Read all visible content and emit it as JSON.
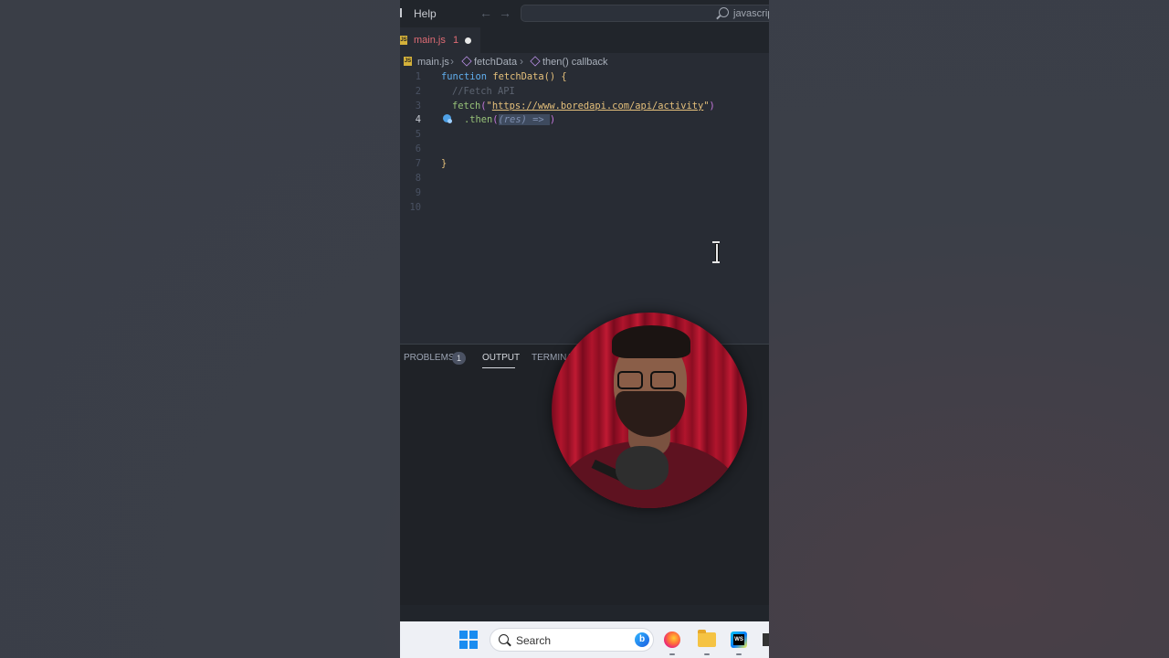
{
  "titlebar": {
    "menu_help": "Help",
    "back_arrow": "←",
    "forward_arrow": "→",
    "command_center_text": "javascript"
  },
  "tab": {
    "js_icon": "JS",
    "filename": "main.js",
    "problem_count": "1"
  },
  "breadcrumb": {
    "file": "main.js",
    "separator": "›",
    "function": "fetchData",
    "callback": "then() callback"
  },
  "editor": {
    "line_numbers": [
      "1",
      "2",
      "3",
      "4",
      "5",
      "6",
      "7",
      "8",
      "9",
      "10"
    ],
    "active_line": "4",
    "line1": {
      "kw": "function",
      "name": "fetchData",
      "parens": "()",
      "brace": "{"
    },
    "line2": {
      "comment": "//Fetch API"
    },
    "line3": {
      "call": "fetch",
      "open": "(",
      "q1": "\"",
      "url": "https://www.boredapi.com/api/activity",
      "q2": "\"",
      "close": ")"
    },
    "line4": {
      "dot_then": ".then",
      "open": "(",
      "hint": "(res) => ",
      "close": ")"
    },
    "line7": {
      "brace": "}"
    }
  },
  "panel": {
    "tabs": [
      {
        "label": "PROBLEMS",
        "badge": "1"
      },
      {
        "label": "OUTPUT"
      },
      {
        "label": "TERMINAL"
      }
    ],
    "active_tab": "OUTPUT"
  },
  "taskbar": {
    "search_label": "Search",
    "bing_label": "b",
    "apps": [
      "windows-start-icon",
      "firefox-icon",
      "file-explorer-icon",
      "webstorm-icon"
    ]
  },
  "colors": {
    "editor_bg": "#282c34",
    "accent_blue": "#61afef",
    "string_yellow": "#e5c07b",
    "error_red": "#e06c75"
  }
}
